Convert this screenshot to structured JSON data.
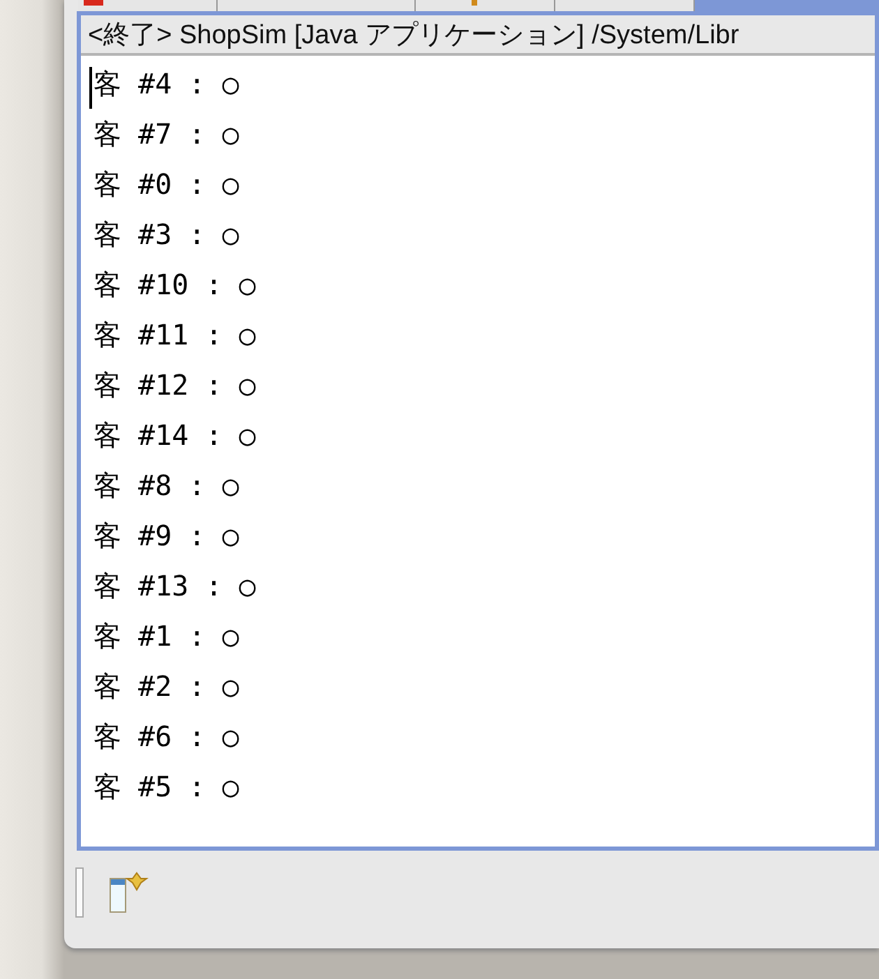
{
  "console": {
    "header": "<終了> ShopSim [Java アプリケーション] /System/Libr",
    "lines": [
      "客 #4 : ○",
      "客 #7 : ○",
      "客 #0 : ○",
      "客 #3 : ○",
      "客 #10 : ○",
      "客 #11 : ○",
      "客 #12 : ○",
      "客 #14 : ○",
      "客 #8 : ○",
      "客 #9 : ○",
      "客 #13 : ○",
      "客 #1 : ○",
      "客 #2 : ○",
      "客 #6 : ○",
      "客 #5 : ○"
    ]
  }
}
